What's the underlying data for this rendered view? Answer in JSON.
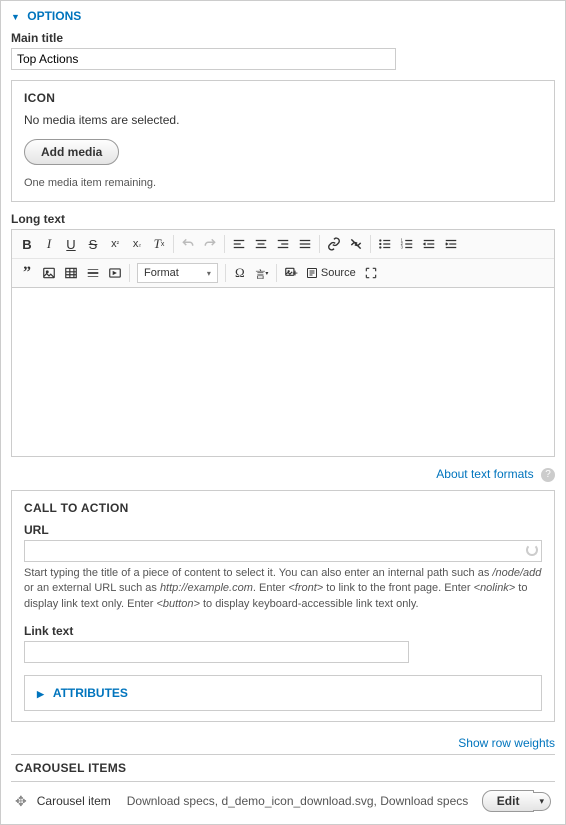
{
  "options": {
    "header": "OPTIONS",
    "main_title_label": "Main title",
    "main_title_value": "Top Actions"
  },
  "icon": {
    "legend": "ICON",
    "empty_msg": "No media items are selected.",
    "add_btn": "Add media",
    "remaining": "One media item remaining."
  },
  "longtext": {
    "label": "Long text",
    "format_label": "Format",
    "source_label": "Source",
    "about_link": "About text formats"
  },
  "cta": {
    "legend": "CALL TO ACTION",
    "url_label": "URL",
    "url_value": "",
    "help_pre": "Start typing the title of a piece of content to select it. You can also enter an internal path such as ",
    "help_i1": "/node/add",
    "help_mid1": " or an external URL such as ",
    "help_i2": "http://example.com",
    "help_mid2": ". Enter ",
    "help_i3": "<front>",
    "help_mid3": " to link to the front page. Enter ",
    "help_i4": "<nolink>",
    "help_mid4": " to display link text only. Enter ",
    "help_i5": "<button>",
    "help_end": " to display keyboard-accessible link text only.",
    "link_label": "Link text",
    "link_value": "",
    "attributes": "ATTRIBUTES"
  },
  "weights_link": "Show row weights",
  "carousel": {
    "header": "CAROUSEL ITEMS",
    "item_label": "Carousel item",
    "files": "Download specs, d_demo_icon_download.svg, Download specs",
    "edit": "Edit"
  }
}
